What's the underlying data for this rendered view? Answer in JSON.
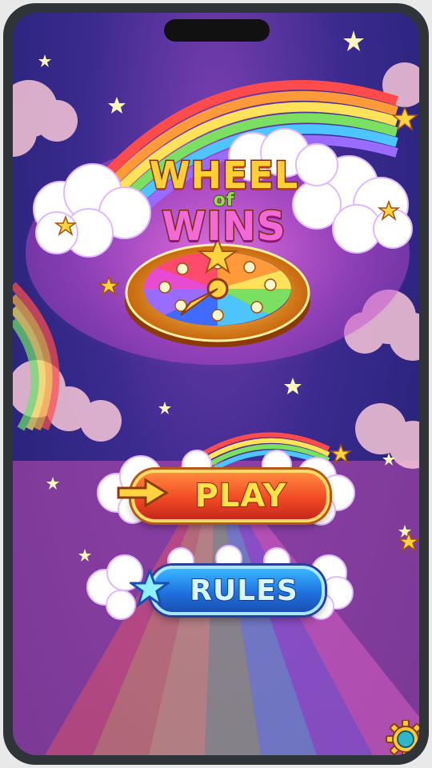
{
  "title": {
    "line1": "WHEEL",
    "line2": "of",
    "line3": "WINS"
  },
  "buttons": {
    "play_label": "PLAY",
    "rules_label": "RULES"
  },
  "icons": {
    "play_arrow": "arrow-right-icon",
    "rules_star": "star-icon",
    "settings": "gear-icon"
  },
  "colors": {
    "play_button": "#f24a26",
    "rules_button": "#1f72e0",
    "title_gold": "#ffd23f",
    "title_pink": "#f26ad6"
  }
}
